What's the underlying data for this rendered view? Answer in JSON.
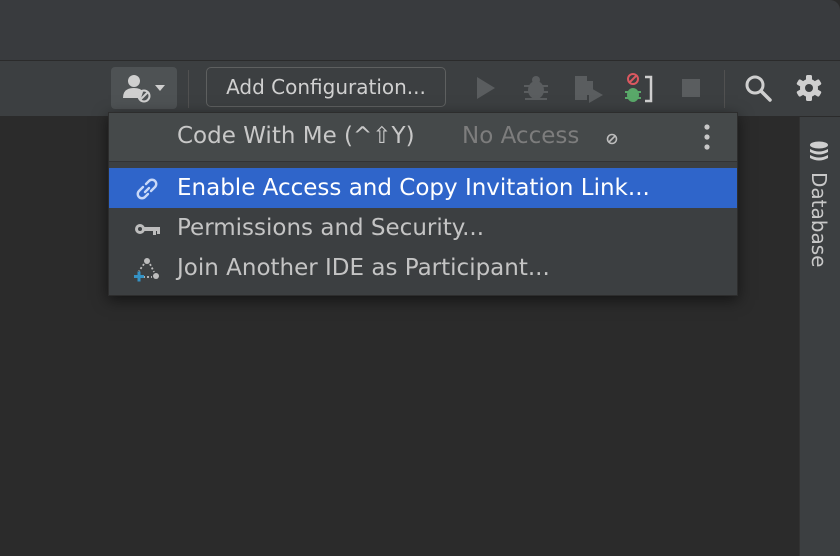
{
  "toolbar": {
    "config_label": "Add Configuration...",
    "icons": [
      "code-with-me-icon",
      "run-icon",
      "debug-icon",
      "coverage-icon",
      "attach-debugger-icon",
      "stop-icon",
      "search-icon",
      "gear-icon"
    ]
  },
  "popup": {
    "title": "Code With Me (^⇧Y)",
    "status": "No Access",
    "items": [
      {
        "label": "Enable Access and Copy Invitation Link...",
        "icon": "link-icon",
        "selected": true
      },
      {
        "label": "Permissions and Security...",
        "icon": "key-icon",
        "selected": false
      },
      {
        "label": "Join Another IDE as Participant...",
        "icon": "join-participant-icon",
        "selected": false
      }
    ]
  },
  "right_stripe": {
    "tab_label": "Database",
    "icon": "database-icon"
  },
  "colors": {
    "selection": "#2f65ca",
    "panel": "#3c3f41",
    "editor": "#2b2b2b",
    "accent_green": "#59a869",
    "accent_red": "#db5860"
  }
}
